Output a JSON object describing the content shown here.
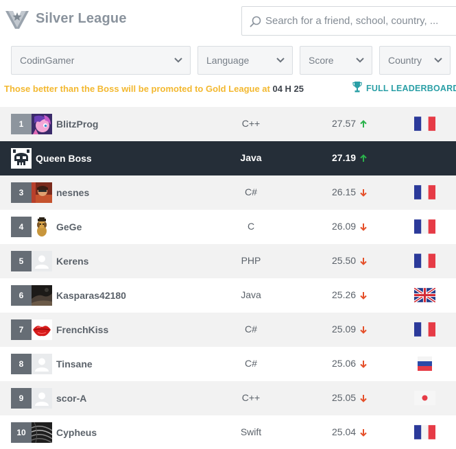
{
  "header": {
    "logo_icon": "silver-league-shield-icon",
    "title": "Silver League",
    "search": {
      "placeholder": "Search for a friend, school, country, ..."
    }
  },
  "filters": [
    {
      "label": "CodinGamer"
    },
    {
      "label": "Language"
    },
    {
      "label": "Score"
    },
    {
      "label": "Country"
    }
  ],
  "promotion": {
    "text": "Those better than the Boss will be promoted to Gold League at ",
    "time": "04 H 25"
  },
  "full_leaderboard_label": "FULL LEADERBOARD",
  "colors": {
    "accent_yellow": "#f3b82f",
    "link_teal": "#2a9fa6",
    "boss_row": "#252e38",
    "trend_up": "#2bb24c",
    "trend_down": "#e5502a"
  },
  "rows": [
    {
      "rank": "1",
      "name": "BlitzProg",
      "language": "C++",
      "score": "27.57",
      "trend": "up",
      "country": "france",
      "avatar": "pony",
      "style": "alt"
    },
    {
      "rank": "",
      "name": "Queen Boss",
      "language": "Java",
      "score": "27.19",
      "trend": "up",
      "country": "",
      "avatar": "skull",
      "style": "boss"
    },
    {
      "rank": "3",
      "name": "nesnes",
      "language": "C#",
      "score": "26.15",
      "trend": "down",
      "country": "france",
      "avatar": "photo-red",
      "style": "alt"
    },
    {
      "rank": "4",
      "name": "GeGe",
      "language": "C",
      "score": "26.09",
      "trend": "down",
      "country": "france",
      "avatar": "dog",
      "style": "white"
    },
    {
      "rank": "5",
      "name": "Kerens",
      "language": "PHP",
      "score": "25.50",
      "trend": "down",
      "country": "france",
      "avatar": "default",
      "style": "alt"
    },
    {
      "rank": "6",
      "name": "Kasparas42180",
      "language": "Java",
      "score": "25.26",
      "trend": "down",
      "country": "uk",
      "avatar": "photo-dark",
      "style": "white"
    },
    {
      "rank": "7",
      "name": "FrenchKiss",
      "language": "C#",
      "score": "25.09",
      "trend": "down",
      "country": "france",
      "avatar": "lips",
      "style": "alt"
    },
    {
      "rank": "8",
      "name": "Tinsane",
      "language": "C#",
      "score": "25.06",
      "trend": "down",
      "country": "russia",
      "avatar": "default",
      "style": "white"
    },
    {
      "rank": "9",
      "name": "scor-A",
      "language": "C++",
      "score": "25.05",
      "trend": "down",
      "country": "japan",
      "avatar": "default",
      "style": "alt"
    },
    {
      "rank": "10",
      "name": "Cypheus",
      "language": "Swift",
      "score": "25.04",
      "trend": "down",
      "country": "france",
      "avatar": "swirl",
      "style": "white"
    }
  ]
}
